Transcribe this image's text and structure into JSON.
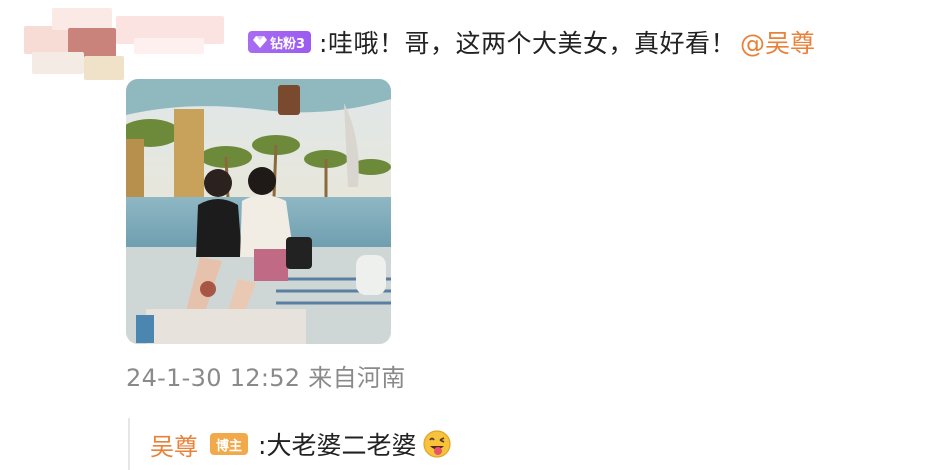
{
  "comment": {
    "fan_badge": "钻粉3",
    "text": ":哇哦！哥，这两个大美女，真好看！",
    "mention": "@吴尊",
    "timestamp": "24-1-30 12:52 来自河南"
  },
  "reply": {
    "author": "吴尊",
    "owner_badge": "博主",
    "text": ":大老婆二老婆"
  },
  "icons": {
    "fan_badge_icon": "diamond-icon",
    "emoji": "tongue-out-emoji"
  },
  "colors": {
    "mention": "#e8823a",
    "fan_badge": "#a86cf1",
    "owner_badge": "#f2a94c",
    "timestamp": "#8a8a8a"
  }
}
